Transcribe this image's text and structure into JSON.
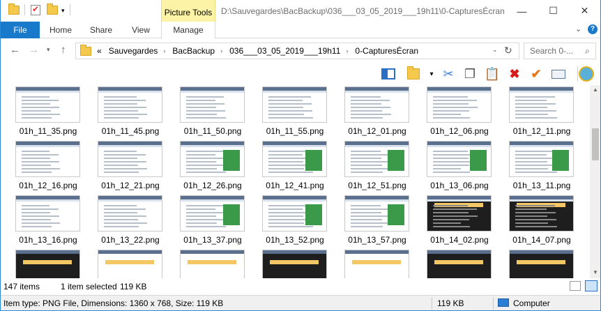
{
  "window": {
    "title_path": "D:\\Sauvegardes\\BacBackup\\036___03_05_2019___19h11\\0-CapturesÉcran",
    "context_tab": "Picture Tools",
    "controls": {
      "minimize": "—",
      "maximize": "☐",
      "close": "✕"
    }
  },
  "ribbon": {
    "tabs": [
      "File",
      "Home",
      "Share",
      "View",
      "Manage"
    ],
    "expand_icon": "chevron-down-icon",
    "help_icon": "help-icon"
  },
  "address": {
    "overflow": "«",
    "crumbs": [
      "Sauvegardes",
      "BacBackup",
      "036___03_05_2019___19h11",
      "0-CapturesÉcran"
    ],
    "search_placeholder": "Search 0-..."
  },
  "files": [
    [
      "01h_11_35.png",
      "01h_11_45.png",
      "01h_11_50.png",
      "01h_11_55.png",
      "01h_12_01.png",
      "01h_12_06.png",
      "01h_12_11.png"
    ],
    [
      "01h_12_16.png",
      "01h_12_21.png",
      "01h_12_26.png",
      "01h_12_41.png",
      "01h_12_51.png",
      "01h_13_06.png",
      "01h_13_11.png"
    ],
    [
      "01h_13_16.png",
      "01h_13_22.png",
      "01h_13_37.png",
      "01h_13_52.png",
      "01h_13_57.png",
      "01h_14_02.png",
      "01h_14_07.png"
    ]
  ],
  "status": {
    "item_count": "147 items",
    "selection": "1 item selected",
    "selection_size": "119 KB"
  },
  "details": {
    "info": "Item type: PNG File, Dimensions: 1360 x 768, Size: 119 KB",
    "size": "119 KB",
    "location": "Computer"
  },
  "colors": {
    "accent": "#1979ca",
    "context_tab": "#fcf3a6"
  }
}
